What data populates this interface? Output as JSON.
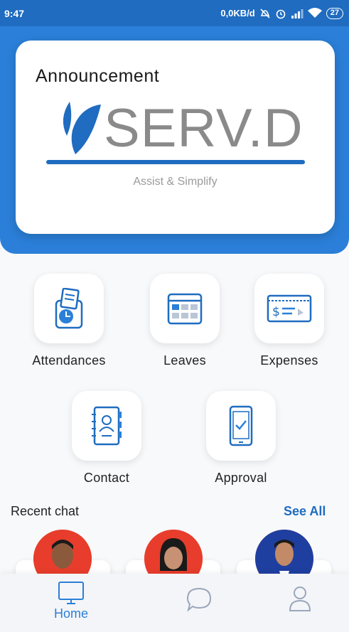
{
  "status_bar": {
    "time": "9:47",
    "network_speed": "0,0KB/d",
    "battery": "27",
    "icons": [
      "mute-icon",
      "alarm-icon",
      "signal-icon",
      "wifi-icon",
      "battery-icon"
    ]
  },
  "announcement": {
    "title": "Announcement",
    "logo_text": "SERV.D",
    "tagline": "Assist & Simplify"
  },
  "menu": {
    "attendances": "Attendances",
    "leaves": "Leaves",
    "expenses": "Expenses",
    "contact": "Contact",
    "approval": "Approval"
  },
  "recent_chat": {
    "title": "Recent chat",
    "see_all": "See All"
  },
  "bottom_nav": {
    "home_label": "Home"
  },
  "colors": {
    "primary": "#2b7fd8",
    "primary_dark": "#1f6cc0",
    "logo_gray": "#8a8a8a",
    "avatar_red": "#e83d2c",
    "avatar_blue": "#1f3fa0"
  }
}
